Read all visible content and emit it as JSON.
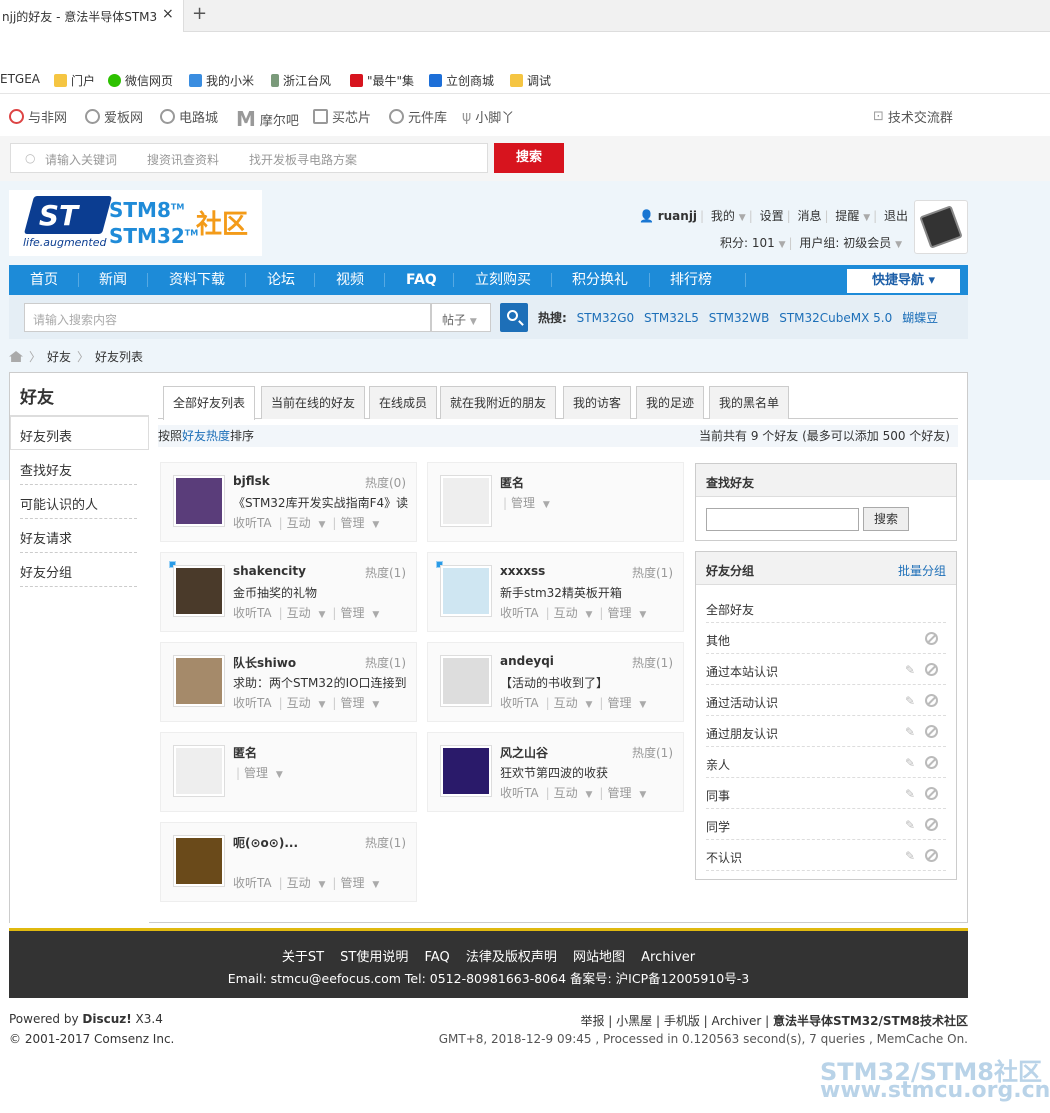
{
  "browser": {
    "tab_title": "njj的好友 - 意法半导体STM3",
    "tab_close": "×",
    "new_tab": "+",
    "bookmarks": [
      "ETGEA",
      "门户",
      "微信网页",
      "我的小米",
      "浙江台风",
      "\"最牛\"集",
      "立创商城",
      "调试"
    ]
  },
  "sitenav": {
    "items": [
      "与非网",
      "爱板网",
      "电路城",
      "摩尔吧",
      "买芯片",
      "元件库",
      "小脚丫"
    ],
    "right": "技术交流群",
    "search_placeholders": [
      "请输入关键词",
      "搜资讯查资料",
      "找开发板寻电路方案"
    ],
    "search_btn": "搜索"
  },
  "logo": {
    "stm8": "STM8",
    "stm32": "STM32",
    "tm": "TM",
    "community": "社区",
    "life": "life.augmented",
    "st": "ST"
  },
  "user": {
    "name": "ruanjj",
    "links": [
      "我的",
      "设置",
      "消息",
      "提醒",
      "退出"
    ],
    "points": "积分: 101",
    "group": "用户组: 初级会员"
  },
  "mainnav": {
    "items": [
      "首页",
      "新闻",
      "资料下载",
      "论坛",
      "视频",
      "FAQ",
      "立刻购买",
      "积分换礼",
      "排行榜"
    ],
    "quick": "快捷导航 ▾"
  },
  "search": {
    "placeholder": "请输入搜索内容",
    "type": "帖子",
    "hot_label": "热搜:",
    "hot": [
      "STM32G0",
      "STM32L5",
      "STM32WB",
      "STM32CubeMX 5.0",
      "蝴蝶豆"
    ]
  },
  "breadcrumb": [
    "好友",
    "好友列表"
  ],
  "side": {
    "title": "好友",
    "items": [
      "好友列表",
      "查找好友",
      "可能认识的人",
      "好友请求",
      "好友分组"
    ]
  },
  "tabs": [
    "全部好友列表",
    "当前在线的好友",
    "在线成员",
    "就在我附近的朋友",
    "我的访客",
    "我的足迹",
    "我的黑名单"
  ],
  "sort": {
    "prefix": "按照",
    "key": "好友热度",
    "suffix": "排序",
    "count_text": "当前共有 9 个好友 (最多可以添加 500 个好友)"
  },
  "actions": {
    "listen": "收听TA",
    "interact": "互动",
    "manage": "管理"
  },
  "friends": [
    {
      "name": "bjflsk",
      "heat": "热度(0)",
      "msg": "《STM32库开发实战指南F4》读",
      "avatar_color": "#5a3d7a",
      "online": false
    },
    {
      "name": "匿名",
      "heat": "",
      "msg": "",
      "avatar_color": "#eeeeee",
      "online": false
    },
    {
      "name": "shakencity",
      "heat": "热度(1)",
      "msg": "金币抽奖的礼物",
      "avatar_color": "#4a3a2a",
      "online": true
    },
    {
      "name": "xxxxss",
      "heat": "热度(1)",
      "msg": "新手stm32精英板开箱",
      "avatar_color": "#cfe6f2",
      "online": true
    },
    {
      "name": "队长shiwo",
      "heat": "热度(1)",
      "msg": "求助：两个STM32的IO口连接到",
      "avatar_color": "#a58a6a",
      "online": false
    },
    {
      "name": "andeyqi",
      "heat": "热度(1)",
      "msg": "【活动的书收到了】",
      "avatar_color": "#dddddd",
      "online": false
    },
    {
      "name": "匿名",
      "heat": "",
      "msg": "",
      "avatar_color": "#eeeeee",
      "online": false
    },
    {
      "name": "风之山谷",
      "heat": "热度(1)",
      "msg": "狂欢节第四波的收获",
      "avatar_color": "#2a1a6a",
      "online": false
    },
    {
      "name": "呃(⊙o⊙)...",
      "heat": "热度(1)",
      "msg": "",
      "avatar_color": "#6a4a1a",
      "online": false
    }
  ],
  "findpanel": {
    "title": "查找好友",
    "btn": "搜索"
  },
  "grouppanel": {
    "title": "好友分组",
    "batch": "批量分组",
    "groups": [
      "全部好友",
      "其他",
      "通过本站认识",
      "通过活动认识",
      "通过朋友认识",
      "亲人",
      "同事",
      "同学",
      "不认识"
    ]
  },
  "footer": {
    "links": [
      "关于ST",
      "ST使用说明",
      "FAQ",
      "法律及版权声明",
      "网站地图",
      "Archiver"
    ],
    "contact": "Email:  stmcu@eefocus.com  Tel: 0512-80981663-8064 备案号: 沪ICP备12005910号-3",
    "powered_prefix": "Powered by ",
    "powered_name": "Discuz!",
    "powered_ver": " X3.4",
    "copyright": "© 2001-2017 Comsenz Inc.",
    "right_links": "举报 | 小黑屋 | 手机版 | Archiver | ",
    "site_name": "意法半导体STM32/STM8技术社区",
    "stats": "GMT+8, 2018-12-9 09:45 , Processed in 0.120563 second(s), 7 queries , MemCache On.",
    "watermark1": "STM32/STM8社区",
    "watermark2": "www.stmcu.org.cn"
  }
}
